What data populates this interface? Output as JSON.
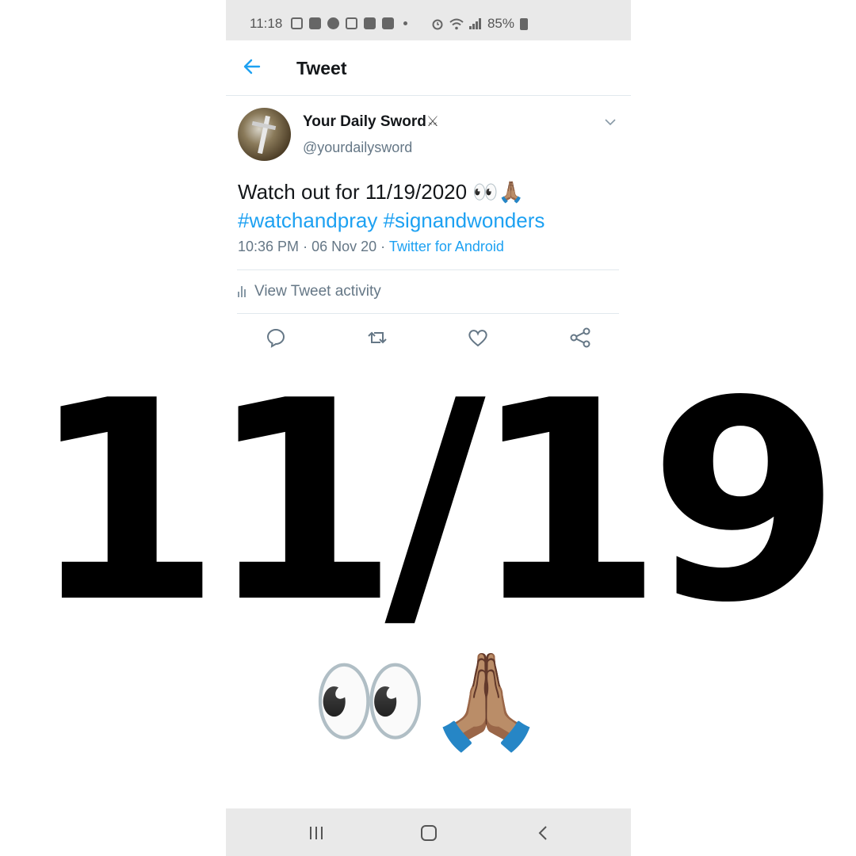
{
  "status_bar": {
    "time": "11:18",
    "battery": "85%",
    "icons": [
      "notification-icon",
      "message-icon",
      "facebook-icon",
      "calendar-icon",
      "youtube-icon",
      "calendar-7-icon",
      "dot-icon",
      "alarm-icon",
      "wifi-icon",
      "signal-icon",
      "battery-icon"
    ]
  },
  "header": {
    "title": "Tweet",
    "back_icon": "arrow-left-icon"
  },
  "tweet": {
    "display_name": "Your Daily Sword",
    "name_emoji": "⚔",
    "handle": "@yourdailysword",
    "text": "Watch out for 11/19/2020 👀🙏🏽",
    "hashtags": [
      "#watchandpray",
      "#signandwonders"
    ],
    "time": "10:36 PM",
    "date": "06 Nov 20",
    "source": "Twitter for Android",
    "activity_label": "View Tweet activity"
  },
  "actions": [
    "reply-icon",
    "retweet-icon",
    "like-icon",
    "share-icon"
  ],
  "caption": {
    "date": "11/19",
    "emoji": "👀🙏🏽"
  },
  "nav_bar": [
    "recent-apps-icon",
    "home-icon",
    "back-icon"
  ],
  "colors": {
    "accent": "#1da1f2",
    "secondary_text": "#657786",
    "status_bar_bg": "#e9e9e9"
  }
}
